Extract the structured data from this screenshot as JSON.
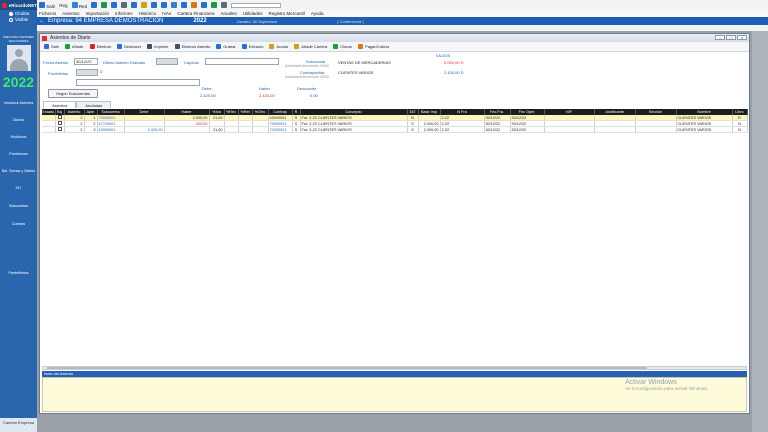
{
  "app": {
    "logo_text": "eRicardoNET",
    "radio_hide": "Ocultar",
    "radio_show": "Visible",
    "user_caption": "SIRCOTEC PARTNER SOLUCIONES",
    "year": "2022",
    "change_company": "Cambio Empresa",
    "search_placeholder": ""
  },
  "toolbar_top": {
    "exit_label": "Salir",
    "reg_label": "Reg",
    "red_label": "Red"
  },
  "menu": [
    "Ficheros",
    "Asientos",
    "Importación",
    "Informes",
    "Histórico",
    "IVAs",
    "Cartera Financiera",
    "Anuales",
    "Utilidades",
    "Registro Mercantil",
    "Ayuda"
  ],
  "company_bar": {
    "arrow": "←",
    "company": "Empresa: 94  EMPRESA DEMOSTRACION",
    "year": "2022",
    "user": "Usuario: 00  Supervisor",
    "mode": "[ Conferencia ]"
  },
  "sidebar_nav": [
    "Introducir Asientos",
    "Diarios",
    "Históricos",
    "Previsiones",
    "Bal. Sumas y Saldos",
    "347",
    "Subcuentas",
    "Cuentas",
    "Predefinidos"
  ],
  "window": {
    "title": "Asientos de Diario",
    "btn_min": "–",
    "btn_max": "□",
    "btn_close": "×"
  },
  "toolbar": [
    {
      "label": "Salir",
      "icon": "exit-icon",
      "color": "#2b6fc7"
    },
    {
      "label": "Añadir",
      "icon": "add-icon",
      "color": "#1e9b3a"
    },
    {
      "label": "Eliminar",
      "icon": "delete-icon",
      "color": "#d02b2b"
    },
    {
      "label": "Deshacer",
      "icon": "undo-icon",
      "color": "#2b6fc7"
    },
    {
      "label": "Imprimir",
      "icon": "printer-icon",
      "color": "#41505f"
    },
    {
      "label": "Eliminar Asiento",
      "icon": "trash-icon",
      "color": "#41505f"
    },
    {
      "label": "Grabar",
      "icon": "save-icon",
      "color": "#2b6fc7"
    },
    {
      "label": "Extracto",
      "icon": "statement-icon",
      "color": "#2b6fc7"
    },
    {
      "label": "Anotar",
      "icon": "pencil-icon",
      "color": "#c9a11b"
    },
    {
      "label": "Añadir Cartera",
      "icon": "wallet-icon",
      "color": "#c9a11b"
    },
    {
      "label": "Clonar",
      "icon": "clone-icon",
      "color": "#1e9b3a"
    },
    {
      "label": "Pagar/Cobrar",
      "icon": "payment-icon",
      "color": "#d9761b"
    }
  ],
  "form": {
    "fecha_label": "Fecha Asiento",
    "fecha_value": "30/12/22",
    "ultimo_label": "Último Asiento Grabado",
    "ultimo_value": "",
    "capitulo_label": "Capítulo",
    "capitulo_value": "",
    "predefinido_label": "Predefinido",
    "segun_button": "Según Subcuentas",
    "subcuenta_label": "Subcuenta",
    "subcuenta_value": "VENTAS DE MERCADERIAS",
    "subcuenta_activity": "Actividad/Intervención 00/00",
    "contrapartida_label": "Contrapartida",
    "contrapartida_value": "CLIENTES VARIOS",
    "contrapartida_activity": "Actividad/Intervención 00/00",
    "saldos_label": "SALDOS",
    "saldo1": "2.000,00 H",
    "saldo2": "2.420,00 D",
    "debe_label": "Debe",
    "debe_value": "2.420,00",
    "haber_label": "Haber",
    "haber_value": "2.420,00",
    "descuadre_label": "Descuadre",
    "descuadre_value": "0,00"
  },
  "tabs": [
    "Asientos",
    "Anotadas"
  ],
  "table": {
    "headers": [
      "Estado",
      "Bq",
      "Asiento",
      "Apte",
      "Subcuenta",
      "Debe",
      "Haber",
      "%Iva",
      "%Rec",
      "%Ret",
      "%Otro",
      "Contrap",
      "R",
      "Concepto",
      "347",
      "Base Imp",
      "N Fra",
      "Fec.Fra.",
      "Fec Oper.",
      "NIF",
      "Justificante",
      "Sección",
      "Nombre",
      "Libro"
    ],
    "rows": [
      [
        "",
        "",
        "2",
        "1",
        "70000001",
        "",
        "2.000,00",
        "21,00",
        "",
        "",
        "",
        "43000001",
        "S",
        "Fra. 2-22 CLIENTES VARIOS",
        "N",
        "",
        "2-22",
        "30/12/22",
        "30/12/22",
        "",
        "",
        "",
        "CLIENTES VARIOS",
        "R"
      ],
      [
        "",
        "",
        "2",
        "2",
        "47700001",
        "",
        "420,00",
        "",
        "",
        "",
        "",
        "70000001",
        "S",
        "Fra. 2-22 CLIENTES VARIOS",
        "S",
        "2.000,00",
        "2-22",
        "30/12/22",
        "30/12/22",
        "",
        "",
        "",
        "CLIENTES VARIOS",
        "N"
      ],
      [
        "",
        "",
        "2",
        "3",
        "43000001",
        "2.420,00",
        "",
        "21,00",
        "",
        "",
        "",
        "70000001",
        "S",
        "Fra. 2-22 CLIENTES VARIOS",
        "S",
        "2.000,00",
        "2-22",
        "30/12/22",
        "30/12/22",
        "",
        "",
        "",
        "CLIENTES VARIOS",
        "N"
      ]
    ]
  },
  "note_header": "Nota del Asiento",
  "watermark": {
    "line1": "Activar Windows",
    "line2": "Ve a Configuración para activar Windows."
  }
}
